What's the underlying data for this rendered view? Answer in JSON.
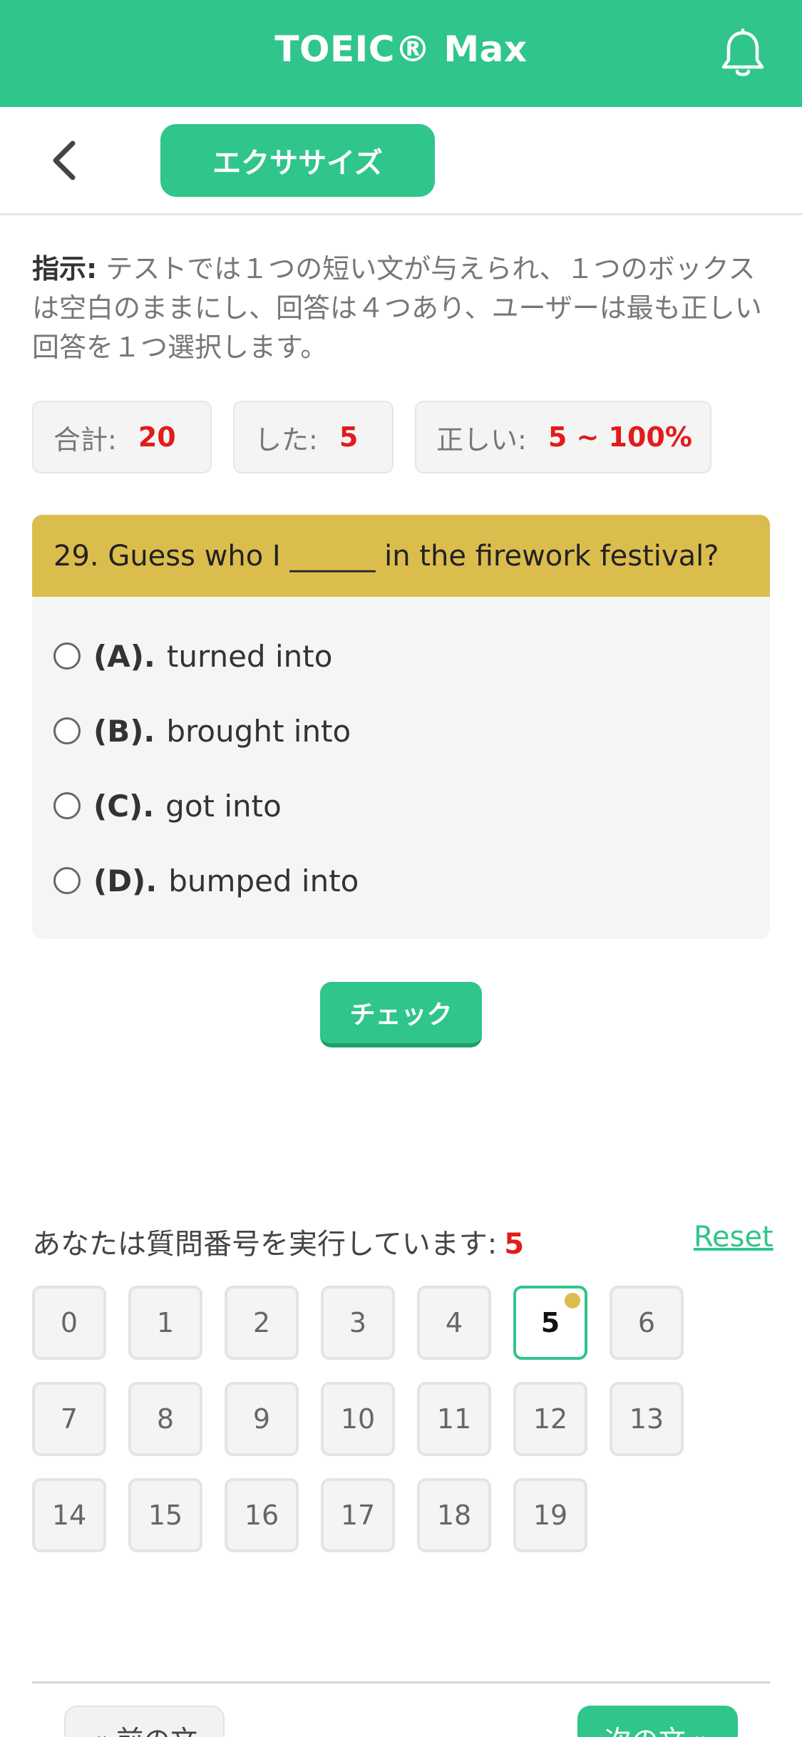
{
  "header": {
    "title": "TOEIC® Max",
    "bell_icon": "bell-icon"
  },
  "subheader": {
    "back_icon": "chevron-left-icon",
    "tab_label": "エクササイズ"
  },
  "instructions": {
    "label": "指示:",
    "text": " テストでは１つの短い文が与えられ、１つのボックスは空白のままにし、回答は４つあり、ユーザーは最も正しい回答を１つ選択します。"
  },
  "stats": {
    "total_label": "合計:",
    "total_value": "20",
    "done_label": "した:",
    "done_value": "5",
    "correct_label": "正しい:",
    "correct_value": "5 ~ 100%"
  },
  "question": {
    "text": "29. Guess who I ______ in the firework festival?",
    "options": [
      {
        "key": "(A).",
        "text": "turned into"
      },
      {
        "key": "(B).",
        "text": "brought into"
      },
      {
        "key": "(C).",
        "text": "got into"
      },
      {
        "key": "(D).",
        "text": "bumped into"
      }
    ]
  },
  "check_label": "チェック",
  "progress": {
    "label": "あなたは質問番号を実行しています:",
    "current": "5",
    "reset_label": "Reset"
  },
  "numbers": [
    "0",
    "1",
    "2",
    "3",
    "4",
    "5",
    "6",
    "7",
    "8",
    "9",
    "10",
    "11",
    "12",
    "13",
    "14",
    "15",
    "16",
    "17",
    "18",
    "19"
  ],
  "nav": {
    "prev_label": "« 前の文",
    "next_label": "次の文 »"
  },
  "colors": {
    "accent": "#2fc58b",
    "question_bar": "#dbbd4e",
    "highlight": "#e21b1b"
  }
}
